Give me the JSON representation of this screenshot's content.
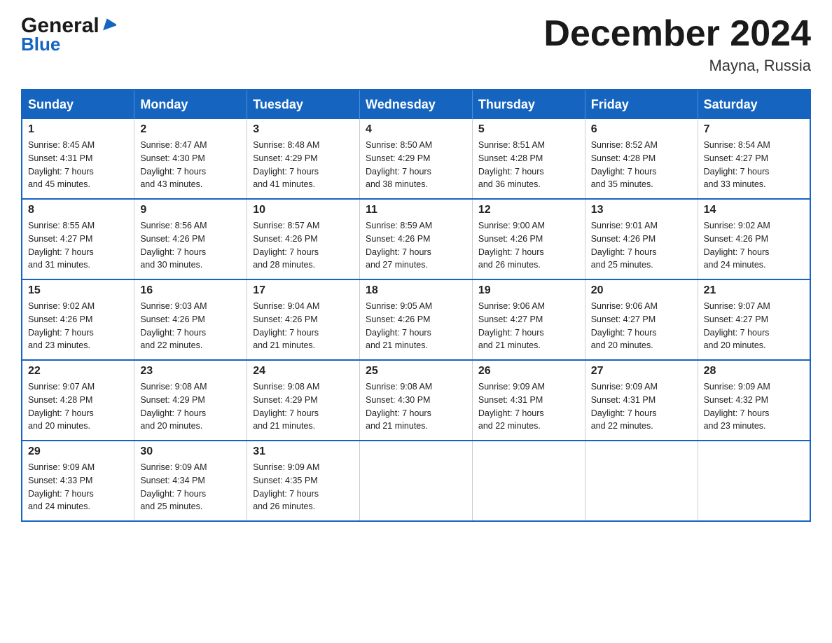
{
  "header": {
    "logo_general": "General",
    "logo_blue": "Blue",
    "calendar_title": "December 2024",
    "calendar_subtitle": "Mayna, Russia"
  },
  "weekdays": [
    "Sunday",
    "Monday",
    "Tuesday",
    "Wednesday",
    "Thursday",
    "Friday",
    "Saturday"
  ],
  "weeks": [
    [
      {
        "day": "1",
        "sunrise": "8:45 AM",
        "sunset": "4:31 PM",
        "daylight": "7 hours and 45 minutes."
      },
      {
        "day": "2",
        "sunrise": "8:47 AM",
        "sunset": "4:30 PM",
        "daylight": "7 hours and 43 minutes."
      },
      {
        "day": "3",
        "sunrise": "8:48 AM",
        "sunset": "4:29 PM",
        "daylight": "7 hours and 41 minutes."
      },
      {
        "day": "4",
        "sunrise": "8:50 AM",
        "sunset": "4:29 PM",
        "daylight": "7 hours and 38 minutes."
      },
      {
        "day": "5",
        "sunrise": "8:51 AM",
        "sunset": "4:28 PM",
        "daylight": "7 hours and 36 minutes."
      },
      {
        "day": "6",
        "sunrise": "8:52 AM",
        "sunset": "4:28 PM",
        "daylight": "7 hours and 35 minutes."
      },
      {
        "day": "7",
        "sunrise": "8:54 AM",
        "sunset": "4:27 PM",
        "daylight": "7 hours and 33 minutes."
      }
    ],
    [
      {
        "day": "8",
        "sunrise": "8:55 AM",
        "sunset": "4:27 PM",
        "daylight": "7 hours and 31 minutes."
      },
      {
        "day": "9",
        "sunrise": "8:56 AM",
        "sunset": "4:26 PM",
        "daylight": "7 hours and 30 minutes."
      },
      {
        "day": "10",
        "sunrise": "8:57 AM",
        "sunset": "4:26 PM",
        "daylight": "7 hours and 28 minutes."
      },
      {
        "day": "11",
        "sunrise": "8:59 AM",
        "sunset": "4:26 PM",
        "daylight": "7 hours and 27 minutes."
      },
      {
        "day": "12",
        "sunrise": "9:00 AM",
        "sunset": "4:26 PM",
        "daylight": "7 hours and 26 minutes."
      },
      {
        "day": "13",
        "sunrise": "9:01 AM",
        "sunset": "4:26 PM",
        "daylight": "7 hours and 25 minutes."
      },
      {
        "day": "14",
        "sunrise": "9:02 AM",
        "sunset": "4:26 PM",
        "daylight": "7 hours and 24 minutes."
      }
    ],
    [
      {
        "day": "15",
        "sunrise": "9:02 AM",
        "sunset": "4:26 PM",
        "daylight": "7 hours and 23 minutes."
      },
      {
        "day": "16",
        "sunrise": "9:03 AM",
        "sunset": "4:26 PM",
        "daylight": "7 hours and 22 minutes."
      },
      {
        "day": "17",
        "sunrise": "9:04 AM",
        "sunset": "4:26 PM",
        "daylight": "7 hours and 21 minutes."
      },
      {
        "day": "18",
        "sunrise": "9:05 AM",
        "sunset": "4:26 PM",
        "daylight": "7 hours and 21 minutes."
      },
      {
        "day": "19",
        "sunrise": "9:06 AM",
        "sunset": "4:27 PM",
        "daylight": "7 hours and 21 minutes."
      },
      {
        "day": "20",
        "sunrise": "9:06 AM",
        "sunset": "4:27 PM",
        "daylight": "7 hours and 20 minutes."
      },
      {
        "day": "21",
        "sunrise": "9:07 AM",
        "sunset": "4:27 PM",
        "daylight": "7 hours and 20 minutes."
      }
    ],
    [
      {
        "day": "22",
        "sunrise": "9:07 AM",
        "sunset": "4:28 PM",
        "daylight": "7 hours and 20 minutes."
      },
      {
        "day": "23",
        "sunrise": "9:08 AM",
        "sunset": "4:29 PM",
        "daylight": "7 hours and 20 minutes."
      },
      {
        "day": "24",
        "sunrise": "9:08 AM",
        "sunset": "4:29 PM",
        "daylight": "7 hours and 21 minutes."
      },
      {
        "day": "25",
        "sunrise": "9:08 AM",
        "sunset": "4:30 PM",
        "daylight": "7 hours and 21 minutes."
      },
      {
        "day": "26",
        "sunrise": "9:09 AM",
        "sunset": "4:31 PM",
        "daylight": "7 hours and 22 minutes."
      },
      {
        "day": "27",
        "sunrise": "9:09 AM",
        "sunset": "4:31 PM",
        "daylight": "7 hours and 22 minutes."
      },
      {
        "day": "28",
        "sunrise": "9:09 AM",
        "sunset": "4:32 PM",
        "daylight": "7 hours and 23 minutes."
      }
    ],
    [
      {
        "day": "29",
        "sunrise": "9:09 AM",
        "sunset": "4:33 PM",
        "daylight": "7 hours and 24 minutes."
      },
      {
        "day": "30",
        "sunrise": "9:09 AM",
        "sunset": "4:34 PM",
        "daylight": "7 hours and 25 minutes."
      },
      {
        "day": "31",
        "sunrise": "9:09 AM",
        "sunset": "4:35 PM",
        "daylight": "7 hours and 26 minutes."
      },
      null,
      null,
      null,
      null
    ]
  ],
  "labels": {
    "sunrise": "Sunrise:",
    "sunset": "Sunset:",
    "daylight": "Daylight:"
  }
}
